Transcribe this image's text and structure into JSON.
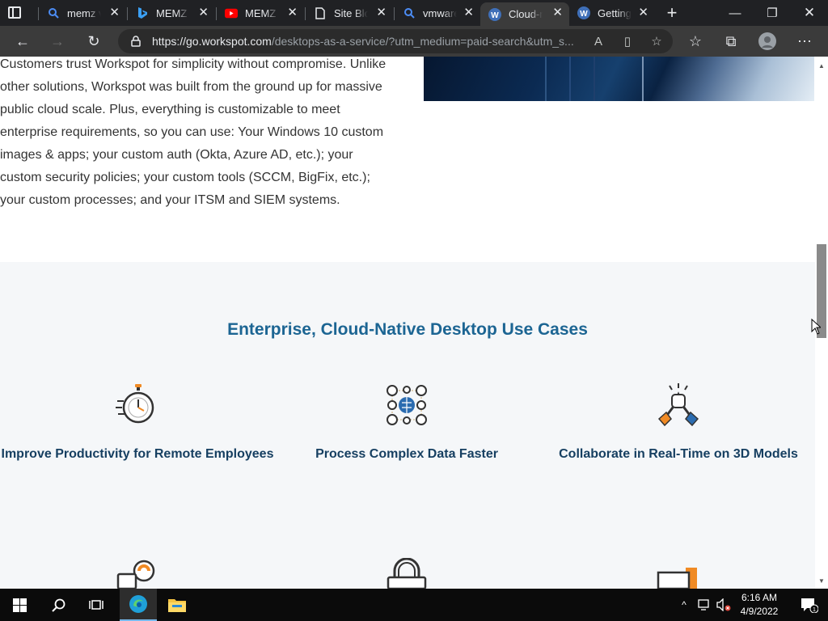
{
  "browser": {
    "tabs": [
      {
        "title": "memz vi",
        "icon": "search-icon"
      },
      {
        "title": "MEMZ v",
        "icon": "bing-icon"
      },
      {
        "title": "MEMZ v",
        "icon": "youtube-icon"
      },
      {
        "title": "Site Bloc",
        "icon": "page-icon"
      },
      {
        "title": "vmware",
        "icon": "search-icon"
      },
      {
        "title": "Cloud-n",
        "icon": "workspot-icon",
        "active": true
      },
      {
        "title": "Getting",
        "icon": "workspot-icon"
      }
    ],
    "url_host": "https://go.workspot.com",
    "url_rest": "/desktops-as-a-service/?utm_medium=paid-search&utm_s..."
  },
  "page": {
    "intro_paragraph": "Customers trust Workspot for simplicity without compromise. Unlike other solutions, Workspot was built from the ground up for massive public cloud scale. Plus, everything is customizable to meet enterprise requirements, so you can use: Your Windows 10 custom images & apps; your custom auth (Okta, Azure AD, etc.); your custom security policies; your custom tools (SCCM, BigFix, etc.); your custom processes; and your ITSM and SIEM systems.",
    "section_title": "Enterprise, Cloud-Native Desktop Use Cases",
    "use_cases": [
      {
        "label": "Improve Productivity for Remote Employees",
        "icon": "stopwatch-icon"
      },
      {
        "label": "Process Complex Data Faster",
        "icon": "network-data-icon"
      },
      {
        "label": "Collaborate in Real-Time on 3D Models",
        "icon": "handshake-icon"
      }
    ]
  },
  "taskbar": {
    "time": "6:16 AM",
    "date": "4/9/2022",
    "notification_count": "1"
  },
  "colors": {
    "section_title": "#1c6593",
    "use_case_label": "#163f61",
    "accent_orange": "#f08a24"
  }
}
